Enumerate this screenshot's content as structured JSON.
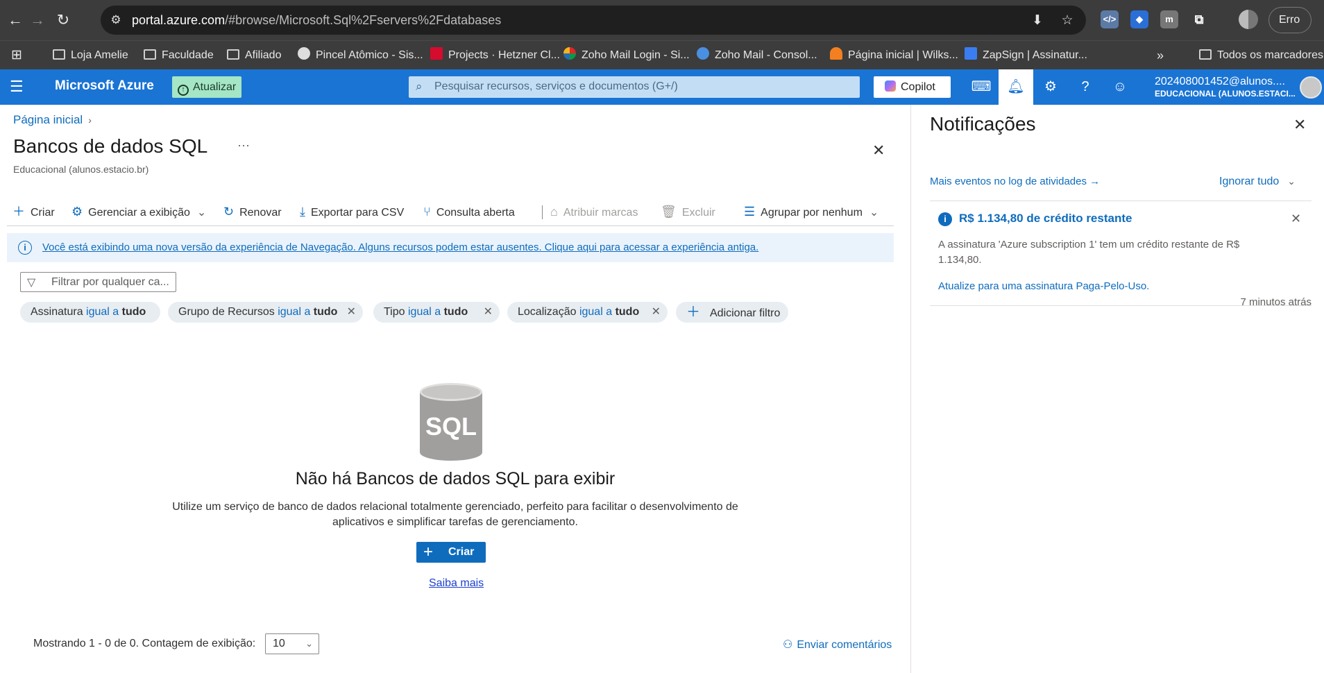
{
  "browser": {
    "url_host": "portal.azure.com",
    "url_path": "/#browse/Microsoft.Sql%2Fservers%2Fdatabases",
    "error_label": "Erro",
    "bookmarks": [
      "Loja Amelie",
      "Faculdade",
      "Afiliado",
      "Pincel Atômico - Sis...",
      "Projects · Hetzner Cl...",
      "Zoho Mail Login - Si...",
      "Zoho Mail - Consol...",
      "Página inicial | Wilks...",
      "ZapSign | Assinatur..."
    ],
    "all_bookmarks": "Todos os marcadores",
    "overflow": "»"
  },
  "header": {
    "brand": "Microsoft Azure",
    "update_button": "Atualizar",
    "search_placeholder": "Pesquisar recursos, serviços e documentos (G+/)",
    "copilot": "Copilot",
    "account_email": "202408001452@alunos....",
    "account_tenant": "EDUCACIONAL (ALUNOS.ESTACI..."
  },
  "main": {
    "breadcrumb": "Página inicial",
    "title": "Bancos de dados SQL",
    "subtitle": "Educacional (alunos.estacio.br)",
    "toolbar": {
      "create": "Criar",
      "manage_view": "Gerenciar a exibição",
      "refresh": "Renovar",
      "export_csv": "Exportar para CSV",
      "open_query": "Consulta aberta",
      "assign_tags": "Atribuir marcas",
      "delete": "Excluir",
      "group_by": "Agrupar por nenhum"
    },
    "info_message": "Você está exibindo uma nova versão da experiência de Navegação. Alguns recursos podem estar ausentes. Clique aqui para acessar a experiência antiga.",
    "filter_placeholder": "Filtrar por qualquer ca...",
    "filters": [
      {
        "field": "Assinatura",
        "op": "igual a",
        "value": "tudo"
      },
      {
        "field": "Grupo de Recursos",
        "op": "igual a",
        "value": "tudo"
      },
      {
        "field": "Tipo",
        "op": "igual a",
        "value": "tudo"
      },
      {
        "field": "Localização",
        "op": "igual a",
        "value": "tudo"
      }
    ],
    "add_filter": "Adicionar filtro",
    "empty_icon_label": "SQL",
    "empty_title": "Não há Bancos de dados SQL para exibir",
    "empty_description": "Utilize um serviço de banco de dados relacional totalmente gerenciado, perfeito para facilitar o desenvolvimento de aplicativos e simplificar tarefas de gerenciamento.",
    "create_button": "Criar",
    "learn_more": "Saiba mais",
    "footer_count": "Mostrando 1 - 0 de 0. Contagem de exibição:",
    "page_size": "10",
    "feedback": "Enviar comentários"
  },
  "notifications": {
    "title": "Notificações",
    "activity_log_link": "Mais eventos no log de atividades →",
    "dismiss_all": "Ignorar tudo",
    "items": [
      {
        "title": "R$ 1.134,80 de crédito restante",
        "message": "A assinatura 'Azure subscription 1' tem um crédito restante de R$ 1.134,80.",
        "action": "Atualize para uma assinatura Paga-Pelo-Uso.",
        "time": "7 minutos atrás"
      }
    ]
  },
  "colors": {
    "azure_header": "#1a74d4",
    "link_blue": "#0f6cbd",
    "update_button": "#a4e6c5",
    "search_bg": "#c3def4",
    "info_bar": "#eaf3fb",
    "filter_pill": "#e8edf2"
  }
}
